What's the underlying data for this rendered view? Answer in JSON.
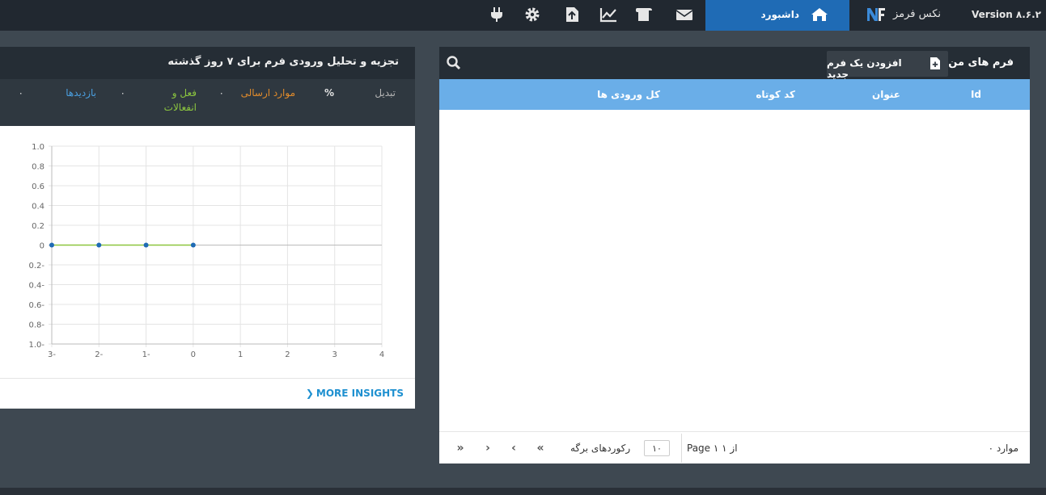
{
  "topbar": {
    "version": "Version ۸.۶.۲",
    "brand": "نکس فرمز",
    "dashboard_label": "داشبورد",
    "icons": [
      "envelope-icon",
      "scroll-icon",
      "chart-line-icon",
      "file-upload-icon",
      "gear-icon",
      "plug-icon"
    ]
  },
  "analytics": {
    "title": "تجزیه و تحلیل ورودی فرم برای ۷ روز گذشته",
    "legend": {
      "conversion": "تبدیل",
      "percent": "%",
      "submissions": "موارد ارسالی",
      "dot1": "۰",
      "actions": "فعل و انفعالات",
      "dot2": "۰",
      "visits": "بازدیدها",
      "dot3": "۰"
    },
    "more_insights": "MORE INSIGHTS"
  },
  "chart_data": {
    "type": "line",
    "x": [
      -3,
      -2,
      -1,
      0
    ],
    "series": [
      {
        "values": [
          0,
          0,
          0,
          0
        ]
      }
    ],
    "xlim": [
      -3,
      4
    ],
    "ylim": [
      -1.0,
      1.0
    ],
    "xticks": [
      "3-",
      "2-",
      "1-",
      "0",
      "1",
      "2",
      "3",
      "4"
    ],
    "yticks": [
      "1.0",
      "0.8",
      "0.6",
      "0.4",
      "0.2",
      "0",
      "0.2-",
      "0.4-",
      "0.6-",
      "0.8-",
      "1.0-"
    ],
    "grid": true,
    "line_color": "#8cc63f",
    "point_color": "#1f6bb5"
  },
  "forms": {
    "title": "فرم های من",
    "add_button": "افزودن یک فرم جدید",
    "columns": {
      "id": "Id",
      "title": "عنوان",
      "shortcode": "کد کوتاه",
      "entries": "کل ورودی ها"
    },
    "rows": [],
    "pager": {
      "items": "۰ موارد",
      "page_info": "Page ۱ از ۱",
      "per_page_value": "۱۰",
      "records_label": "رکوردهای برگه",
      "first": "«",
      "prev": "‹",
      "next": "›",
      "last": "»"
    }
  },
  "colors": {
    "topbar": "#212830",
    "accent": "#1f6bb5",
    "table_header": "#6aaee8",
    "background": "#3e4851"
  }
}
